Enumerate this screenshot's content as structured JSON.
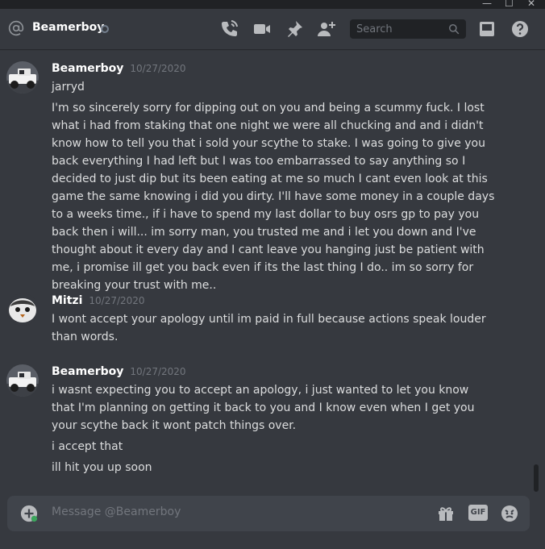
{
  "window": {
    "controls": [
      "—",
      "☐",
      "✕"
    ]
  },
  "header": {
    "username": "Beamerboy",
    "icons": [
      "at-icon",
      "phone-call-icon",
      "video-call-icon",
      "pin-icon",
      "add-friend-icon",
      "inbox-icon",
      "help-icon"
    ],
    "search_placeholder": "Search"
  },
  "messages": [
    {
      "author": "Beamerboy",
      "timestamp": "10/27/2020",
      "lines": [
        "jarryd",
        "I'm so sincerely sorry for dipping out on you and being a scummy fuck. I lost what  i had from staking that one night we were all chucking and  and i didn't know how to tell you that i sold your scythe to stake. I was going to give you back everything I had left but I was too embarrassed to say anything so I decided to just dip but its been eating at me so much I cant even look at this game the same knowing i did you dirty. I'll have some money in a couple days to a weeks time., if i have to spend my last dollar to buy osrs gp to pay you back then i will... im sorry man, you trusted me and i let you down and I've thought about it every day and I cant leave you hanging just be patient with me, i promise ill get you back even if its the last thing I do.. im so sorry for breaking your trust with me.."
      ]
    },
    {
      "author": "Mitzi",
      "timestamp": "10/27/2020",
      "lines": [
        "I wont accept your apology until im paid in full because actions speak louder than words."
      ]
    },
    {
      "author": "Beamerboy",
      "timestamp": "10/27/2020",
      "lines": [
        "i wasnt expecting you to accept an apology, i just wanted to let you know that I'm planning on getting it back to you  and I know even when I get you your scythe back it wont patch things over.",
        "i accept that",
        "ill hit you up soon"
      ]
    }
  ],
  "composer": {
    "placeholder": "Message @Beamerboy",
    "icons": [
      "gift-icon",
      "gif-icon",
      "emoji-icon"
    ],
    "gif_label": "GIF"
  },
  "colors": {
    "background": "#36393f",
    "header_text": "#ffffff",
    "message_text": "#dcddde",
    "muted": "#72767d",
    "input_bg": "#40444b",
    "dark": "#202225"
  }
}
